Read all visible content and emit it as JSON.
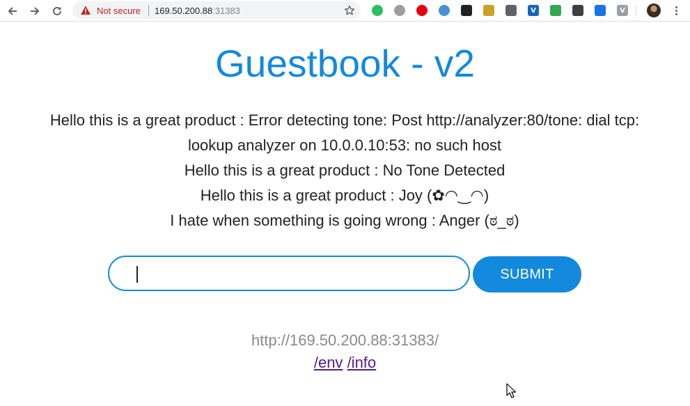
{
  "browser": {
    "security_label": "Not secure",
    "url_host": "169.50.200.88",
    "url_port": ":31383",
    "extensions": [
      {
        "name": "evernote-icon",
        "color": "#2dbe60",
        "glyph": ""
      },
      {
        "name": "grey-circle-icon",
        "color": "#9e9e9e",
        "glyph": ""
      },
      {
        "name": "opera-icon",
        "color": "#e3000f",
        "glyph": ""
      },
      {
        "name": "globe-icon",
        "color": "#4a90d9",
        "glyph": ""
      },
      {
        "name": "camera-icon",
        "color": "#202124",
        "glyph": ""
      },
      {
        "name": "image-icon",
        "color": "#c9a227",
        "glyph": ""
      },
      {
        "name": "chat-icon",
        "color": "#5f6368",
        "glyph": ""
      },
      {
        "name": "v-icon",
        "color": "#1565c0",
        "glyph": "V"
      },
      {
        "name": "pulse-icon",
        "color": "#34a853",
        "glyph": ""
      },
      {
        "name": "lock-badge-icon",
        "color": "#3c4043",
        "glyph": ""
      },
      {
        "name": "layers-icon",
        "color": "#1a73e8",
        "glyph": ""
      },
      {
        "name": "v-grey-icon",
        "color": "#9aa0a6",
        "glyph": "V"
      }
    ]
  },
  "page": {
    "title": "Guestbook - v2",
    "entries": [
      "Hello this is a great product : Error detecting tone: Post http://analyzer:80/tone: dial tcp:",
      "lookup analyzer on 10.0.0.10:53: no such host",
      "Hello this is a great product : No Tone Detected",
      "Hello this is a great product : Joy (✿◠‿◠)",
      "I hate when something is going wrong : Anger (ಠ_ಠ)"
    ],
    "input_value": "",
    "submit_label": "SUBMIT",
    "host_url": "http://169.50.200.88:31383/",
    "link_env": "/env",
    "link_info": "/info"
  },
  "colors": {
    "accent": "#1389dd",
    "warning": "#c5221f",
    "visited_link": "#551a8b"
  }
}
